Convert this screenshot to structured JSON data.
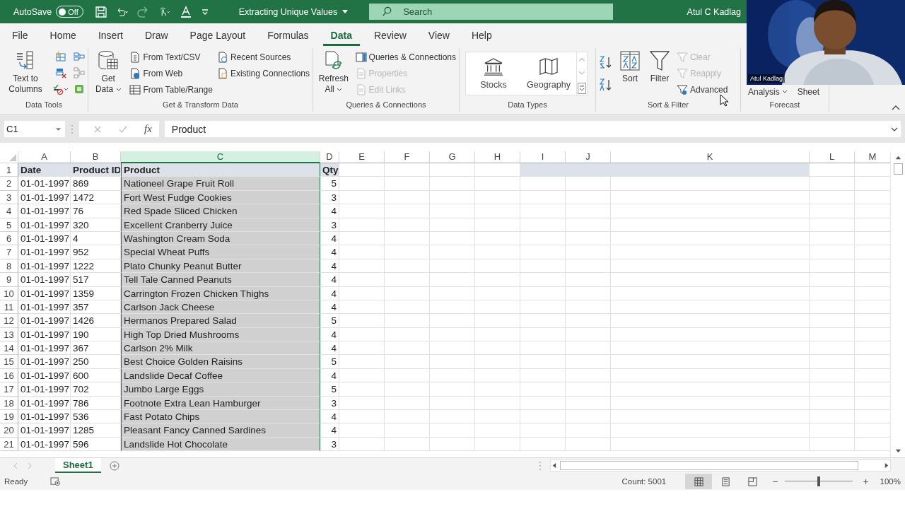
{
  "title_bar": {
    "autosave_label": "AutoSave",
    "autosave_state": "Off",
    "autosave_on": false,
    "document_title": "Extracting Unique Values",
    "search": {
      "placeholder": "Search"
    },
    "user": "Atul C Kadlag"
  },
  "tabs": [
    {
      "label": "File",
      "selected": false
    },
    {
      "label": "Home",
      "selected": false
    },
    {
      "label": "Insert",
      "selected": false
    },
    {
      "label": "Draw",
      "selected": false
    },
    {
      "label": "Page Layout",
      "selected": false
    },
    {
      "label": "Formulas",
      "selected": false
    },
    {
      "label": "Data",
      "selected": true
    },
    {
      "label": "Review",
      "selected": false
    },
    {
      "label": "View",
      "selected": false
    },
    {
      "label": "Help",
      "selected": false
    }
  ],
  "ribbon": {
    "groups": [
      {
        "label": "Data Tools",
        "items": [
          {
            "label": "Text to Columns",
            "disabled": false
          }
        ]
      },
      {
        "label": "Get & Transform Data",
        "items": [
          {
            "label": "Get Data",
            "disabled": false
          },
          {
            "label": "From Text/CSV",
            "disabled": false
          },
          {
            "label": "From Web",
            "disabled": false
          },
          {
            "label": "From Table/Range",
            "disabled": false
          },
          {
            "label": "Recent Sources",
            "disabled": false
          },
          {
            "label": "Existing Connections",
            "disabled": false
          }
        ]
      },
      {
        "label": "Queries & Connections",
        "items": [
          {
            "label": "Refresh All",
            "disabled": false
          },
          {
            "label": "Queries & Connections",
            "disabled": false
          },
          {
            "label": "Properties",
            "disabled": true
          },
          {
            "label": "Edit Links",
            "disabled": true
          }
        ]
      },
      {
        "label": "Data Types",
        "items": [
          {
            "label": "Stocks"
          },
          {
            "label": "Geography"
          }
        ]
      },
      {
        "label": "Sort & Filter",
        "items": [
          {
            "label": "Sort",
            "disabled": false
          },
          {
            "label": "Filter",
            "disabled": false
          },
          {
            "label": "Clear",
            "disabled": true
          },
          {
            "label": "Reapply",
            "disabled": true
          },
          {
            "label": "Advanced",
            "disabled": false
          }
        ]
      },
      {
        "label": "Forecast",
        "items": [
          {
            "label": "Analysis"
          },
          {
            "label": "Sheet"
          }
        ]
      }
    ]
  },
  "video": {
    "kind": "picture",
    "name": "Atul Kadlag"
  },
  "formula_bar": {
    "name_box": "C1",
    "fx": "fx",
    "content": "Product"
  },
  "columns": [
    {
      "label": "A",
      "selected": false
    },
    {
      "label": "B",
      "selected": false
    },
    {
      "label": "C",
      "selected": true
    },
    {
      "label": "D",
      "selected": false
    },
    {
      "label": "E",
      "selected": false
    },
    {
      "label": "F",
      "selected": false
    },
    {
      "label": "G",
      "selected": false
    },
    {
      "label": "H",
      "selected": false
    },
    {
      "label": "I",
      "selected": false
    },
    {
      "label": "J",
      "selected": false
    },
    {
      "label": "K",
      "selected": false
    },
    {
      "label": "L",
      "selected": false
    },
    {
      "label": "M",
      "selected": false
    }
  ],
  "header_row": {
    "num": "1",
    "cells": [
      "Date",
      "Product ID",
      "Product",
      "Qty"
    ]
  },
  "rows": [
    {
      "num": "2",
      "cells": [
        "01-01-1997",
        "869",
        "Nationeel Grape Fruit Roll",
        "5"
      ]
    },
    {
      "num": "3",
      "cells": [
        "01-01-1997",
        "1472",
        "Fort West Fudge Cookies",
        "3"
      ]
    },
    {
      "num": "4",
      "cells": [
        "01-01-1997",
        "76",
        "Red Spade Sliced Chicken",
        "4"
      ]
    },
    {
      "num": "5",
      "cells": [
        "01-01-1997",
        "320",
        "Excellent Cranberry Juice",
        "3"
      ]
    },
    {
      "num": "6",
      "cells": [
        "01-01-1997",
        "4",
        "Washington Cream Soda",
        "4"
      ]
    },
    {
      "num": "7",
      "cells": [
        "01-01-1997",
        "952",
        "Special Wheat Puffs",
        "4"
      ]
    },
    {
      "num": "8",
      "cells": [
        "01-01-1997",
        "1222",
        "Plato Chunky Peanut Butter",
        "4"
      ]
    },
    {
      "num": "9",
      "cells": [
        "01-01-1997",
        "517",
        "Tell Tale Canned Peanuts",
        "4"
      ]
    },
    {
      "num": "10",
      "cells": [
        "01-01-1997",
        "1359",
        "Carrington Frozen Chicken Thighs",
        "4"
      ]
    },
    {
      "num": "11",
      "cells": [
        "01-01-1997",
        "357",
        "Carlson Jack Cheese",
        "4"
      ]
    },
    {
      "num": "12",
      "cells": [
        "01-01-1997",
        "1426",
        "Hermanos Prepared Salad",
        "5"
      ]
    },
    {
      "num": "13",
      "cells": [
        "01-01-1997",
        "190",
        "High Top Dried Mushrooms",
        "4"
      ]
    },
    {
      "num": "14",
      "cells": [
        "01-01-1997",
        "367",
        "Carlson 2% Milk",
        "4"
      ]
    },
    {
      "num": "15",
      "cells": [
        "01-01-1997",
        "250",
        "Best Choice Golden Raisins",
        "5"
      ]
    },
    {
      "num": "16",
      "cells": [
        "01-01-1997",
        "600",
        "Landslide Decaf Coffee",
        "4"
      ]
    },
    {
      "num": "17",
      "cells": [
        "01-01-1997",
        "702",
        "Jumbo Large Eggs",
        "5"
      ]
    },
    {
      "num": "18",
      "cells": [
        "01-01-1997",
        "786",
        "Footnote Extra Lean Hamburger",
        "3"
      ]
    },
    {
      "num": "19",
      "cells": [
        "01-01-1997",
        "536",
        "Fast Potato Chips",
        "4"
      ]
    },
    {
      "num": "20",
      "cells": [
        "01-01-1997",
        "1285",
        "Pleasant Fancy Canned Sardines",
        "4"
      ]
    },
    {
      "num": "21",
      "cells": [
        "01-01-1997",
        "596",
        "Landslide Hot Chocolate",
        "3"
      ]
    }
  ],
  "sheets": [
    {
      "label": "Sheet1",
      "selected": true
    }
  ],
  "status_bar": {
    "status": "Ready",
    "count": "Count: 5001",
    "views": [
      {
        "selected": true
      },
      {
        "selected": false
      },
      {
        "selected": false
      }
    ],
    "zoom": {
      "level": 0.5,
      "reading": "100%",
      "minus": "−",
      "plus": "+"
    }
  }
}
